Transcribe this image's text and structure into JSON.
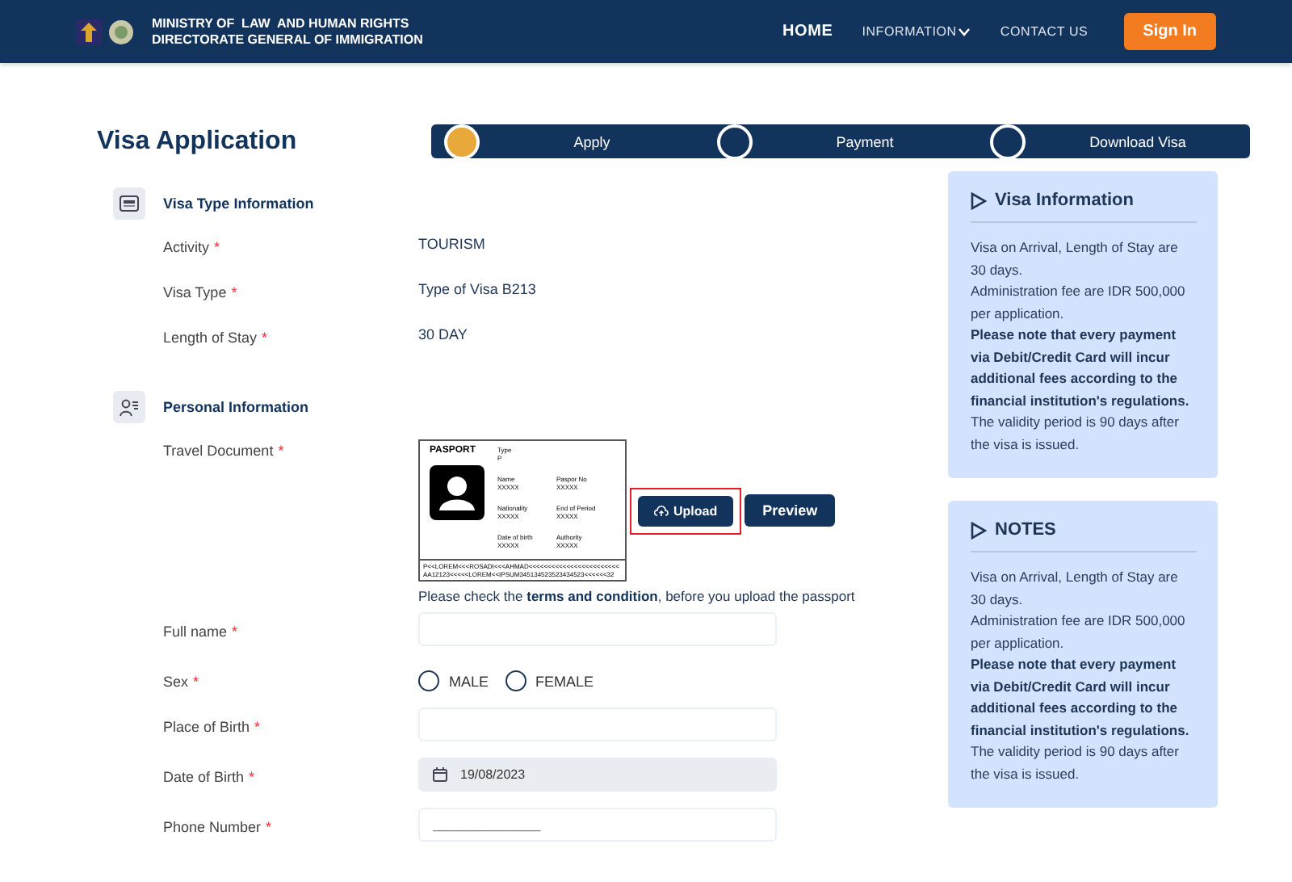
{
  "header": {
    "org_line_1": "MINISTRY OF  LAW  AND HUMAN RIGHTS",
    "org_line_2": "DIRECTORATE GENERAL OF IMMIGRATION",
    "nav": [
      {
        "label": "HOME",
        "selected": true,
        "dropdown": false
      },
      {
        "label": "INFORMATION",
        "selected": false,
        "dropdown": true
      },
      {
        "label": "CONTACT US",
        "selected": false,
        "dropdown": false
      }
    ],
    "sign_in": "Sign In"
  },
  "title": "Visa Application",
  "steps": [
    {
      "label": "Apply",
      "selected": true
    },
    {
      "label": "Payment",
      "selected": false
    },
    {
      "label": "Download Visa",
      "selected": false
    }
  ],
  "sections": [
    {
      "title": "Visa Type Information",
      "rows": [
        {
          "kind": "text",
          "label": "Activity",
          "required": "*",
          "value": "TOURISM"
        },
        {
          "kind": "text",
          "label": "Visa Type",
          "required": "*",
          "value": "Type of Visa B213"
        },
        {
          "kind": "text",
          "label": "Length of Stay",
          "required": "*",
          "value": "30 DAY"
        }
      ]
    },
    {
      "title": "Personal Information",
      "rows": [
        {
          "kind": "document",
          "label": "Travel Document",
          "required": "*",
          "sample": {
            "heading": "PASPORT",
            "fields": [
              {
                "label": "Type",
                "value": "P"
              },
              {
                "label": "Name",
                "value": "XXXXX"
              },
              {
                "label": "Paspor No",
                "value": "XXXXX"
              },
              {
                "label": "Nationality",
                "value": "XXXXX"
              },
              {
                "label": "End of Period",
                "value": "XXXXX"
              },
              {
                "label": "Date of birth",
                "value": "XXXXX"
              },
              {
                "label": "Authority",
                "value": "XXXXX"
              }
            ],
            "mrz": [
              "P<<LOREM<<<ROSADI<<<AHMAD<<<<<<<<<<<<<<<<<<<<<<<<",
              "AA12123<<<<<LOREM<<IPSUM345134523523434523<<<<<<32"
            ]
          },
          "upload": "Upload",
          "upload_highlighted": true,
          "preview": "Preview",
          "note": "Please check the **terms and condition**, before you upload the passport"
        },
        {
          "kind": "input",
          "label": "Full name",
          "required": "*"
        },
        {
          "kind": "radio",
          "label": "Sex",
          "required": "*",
          "options": [
            {
              "label": "MALE",
              "selected": false
            },
            {
              "label": "FEMALE",
              "selected": false
            }
          ]
        },
        {
          "kind": "input",
          "label": "Place of Birth",
          "required": "*"
        },
        {
          "kind": "date",
          "label": "Date of Birth",
          "required": "*",
          "value": "19/08/2023",
          "disabled": true
        },
        {
          "kind": "input",
          "label": "Phone Number",
          "required": "*",
          "placeholder": "_______________"
        }
      ]
    }
  ],
  "panels": [
    {
      "title": "Visa Information",
      "paragraphs": [
        {
          "text": "Visa on Arrival, Length of Stay are 30 days.",
          "bold": false
        },
        {
          "text": "Administration fee are IDR 500,000 per application.",
          "bold": false
        },
        {
          "text": "Please note that every payment via Debit/Credit Card will incur additional fees according to the financial institution's regulations.",
          "bold": true
        },
        {
          "text": "The validity period is 90 days after the visa is issued.",
          "bold": false
        }
      ]
    },
    {
      "title": "NOTES",
      "paragraphs": [
        {
          "text": "Visa on Arrival, Length of Stay are 30 days.",
          "bold": false
        },
        {
          "text": "Administration fee are IDR 500,000 per application.",
          "bold": false
        },
        {
          "text": "Please note that every payment via Debit/Credit Card will incur additional fees according to the financial institution's regulations.",
          "bold": true
        },
        {
          "text": "The validity period is 90 days after the visa is issued.",
          "bold": false
        }
      ]
    }
  ]
}
